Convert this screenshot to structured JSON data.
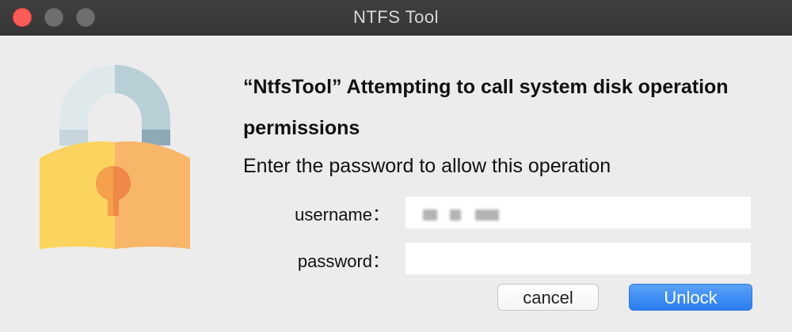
{
  "window": {
    "title": "NTFS Tool"
  },
  "dialog": {
    "headline": "“NtfsTool” Attempting to call system disk operation permissions",
    "subline": "Enter the password to allow this operation",
    "username_label": "username：",
    "password_label": "password：",
    "username_value": "",
    "password_value": "",
    "cancel_label": "cancel",
    "unlock_label": "Unlock"
  },
  "icons": {
    "lock": "padlock-icon"
  },
  "colors": {
    "accent_button": "#2f80f0",
    "lock_yellow": "#fbd35f",
    "lock_orange": "#f7b668",
    "keyhole": "#f0884a",
    "shackle_light": "#dfe9ec",
    "shackle_dark": "#b9cfd6",
    "close_button": "#fc5c57"
  }
}
